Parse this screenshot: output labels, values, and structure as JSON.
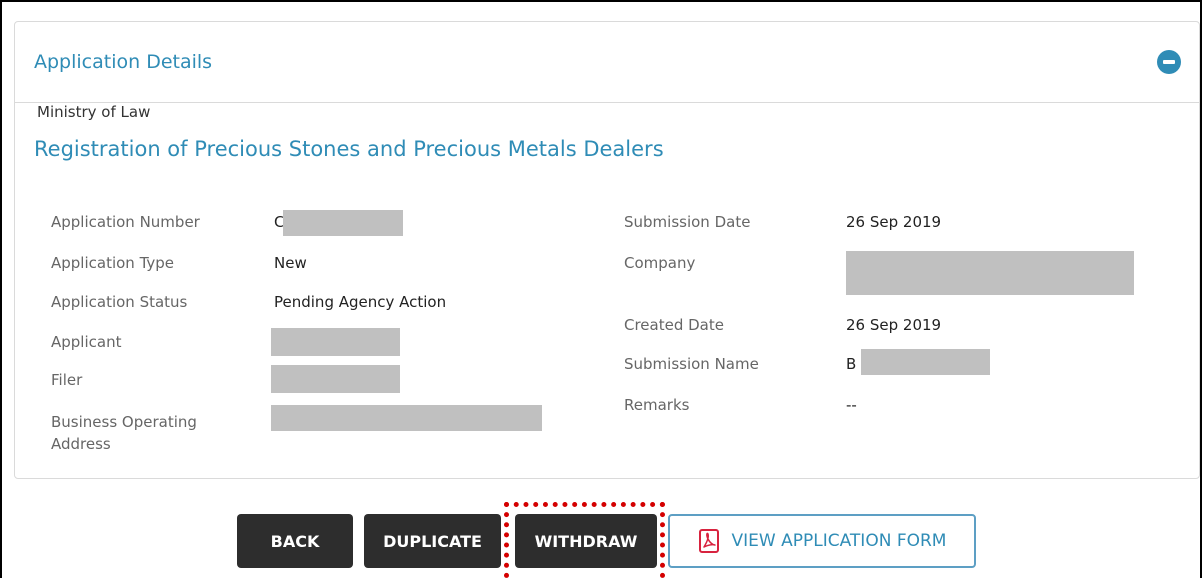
{
  "panel": {
    "title": "Application Details",
    "agency": "Ministry of Law",
    "service": "Registration of Precious Stones and Precious Metals Dealers"
  },
  "details_left": {
    "app_number_label": "Application Number",
    "app_number_value": "C",
    "app_type_label": "Application Type",
    "app_type_value": "New",
    "app_status_label": "Application Status",
    "app_status_value": "Pending Agency Action",
    "applicant_label": "Applicant",
    "filer_label": "Filer",
    "address_label_line1": "Business Operating",
    "address_label_line2": "Address"
  },
  "details_right": {
    "submission_date_label": "Submission Date",
    "submission_date_value": "26 Sep 2019",
    "company_label": "Company",
    "created_date_label": "Created Date",
    "created_date_value": "26 Sep 2019",
    "submission_name_label": "Submission Name",
    "submission_name_value": "B",
    "remarks_label": "Remarks",
    "remarks_value": "--"
  },
  "actions": {
    "back_label": "BACK",
    "duplicate_label": "DUPLICATE",
    "withdraw_label": "WITHDRAW",
    "view_form_label": "VIEW APPLICATION FORM"
  },
  "icons": {
    "collapse": "minus-circle-icon",
    "pdf": "pdf-icon"
  },
  "colors": {
    "accent": "#2f8cb6",
    "button_dark": "#2d2d2d",
    "highlight": "#d40000"
  }
}
